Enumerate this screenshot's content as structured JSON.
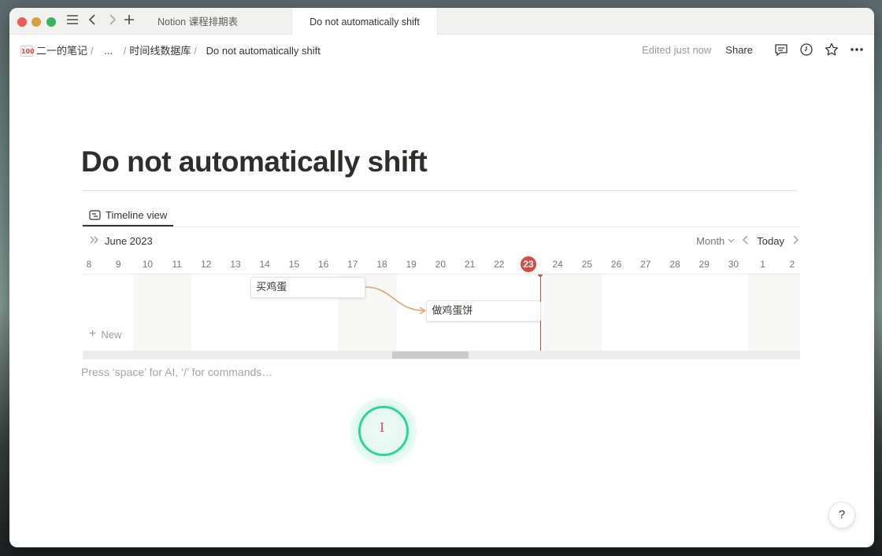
{
  "window": {
    "tabs": [
      {
        "label": "Notion 课程排期表"
      },
      {
        "label": "Do not automatically shift"
      }
    ]
  },
  "topbar": {
    "breadcrumb": {
      "emoji": "100",
      "workspace": "二一的笔记",
      "ellipsis": "...",
      "database": "时间线数据库",
      "page": "Do not automatically shift",
      "separator": "/"
    },
    "edited": "Edited just now",
    "share": "Share",
    "icons": [
      "comment-icon",
      "clock-icon",
      "star-icon",
      "more-icon"
    ]
  },
  "page": {
    "title": "Do not automatically shift",
    "placeholder": "Press ‘space’ for AI, ‘/’ for commands…"
  },
  "timeline": {
    "view_tab": "Timeline view",
    "month": "June 2023",
    "zoom": "Month",
    "today_button": "Today",
    "days": [
      "8",
      "9",
      "10",
      "11",
      "12",
      "13",
      "14",
      "15",
      "16",
      "17",
      "18",
      "19",
      "20",
      "21",
      "22",
      "23",
      "24",
      "25",
      "26",
      "27",
      "28",
      "29",
      "30",
      "1",
      "2"
    ],
    "today": "23",
    "tasks": [
      {
        "name": "买鸡蛋",
        "start_day": "14",
        "end_day": "17"
      },
      {
        "name": "做鸡蛋饼",
        "start_day": "20",
        "end_day": "23"
      }
    ],
    "dependency": {
      "from": "买鸡蛋",
      "to": "做鸡蛋饼"
    },
    "new_label": "New"
  },
  "help": {
    "label": "?"
  },
  "colors": {
    "accent_red": "#d44c47",
    "dependency_orange": "#e0a36a",
    "cursor_green": "#2fd39b"
  }
}
